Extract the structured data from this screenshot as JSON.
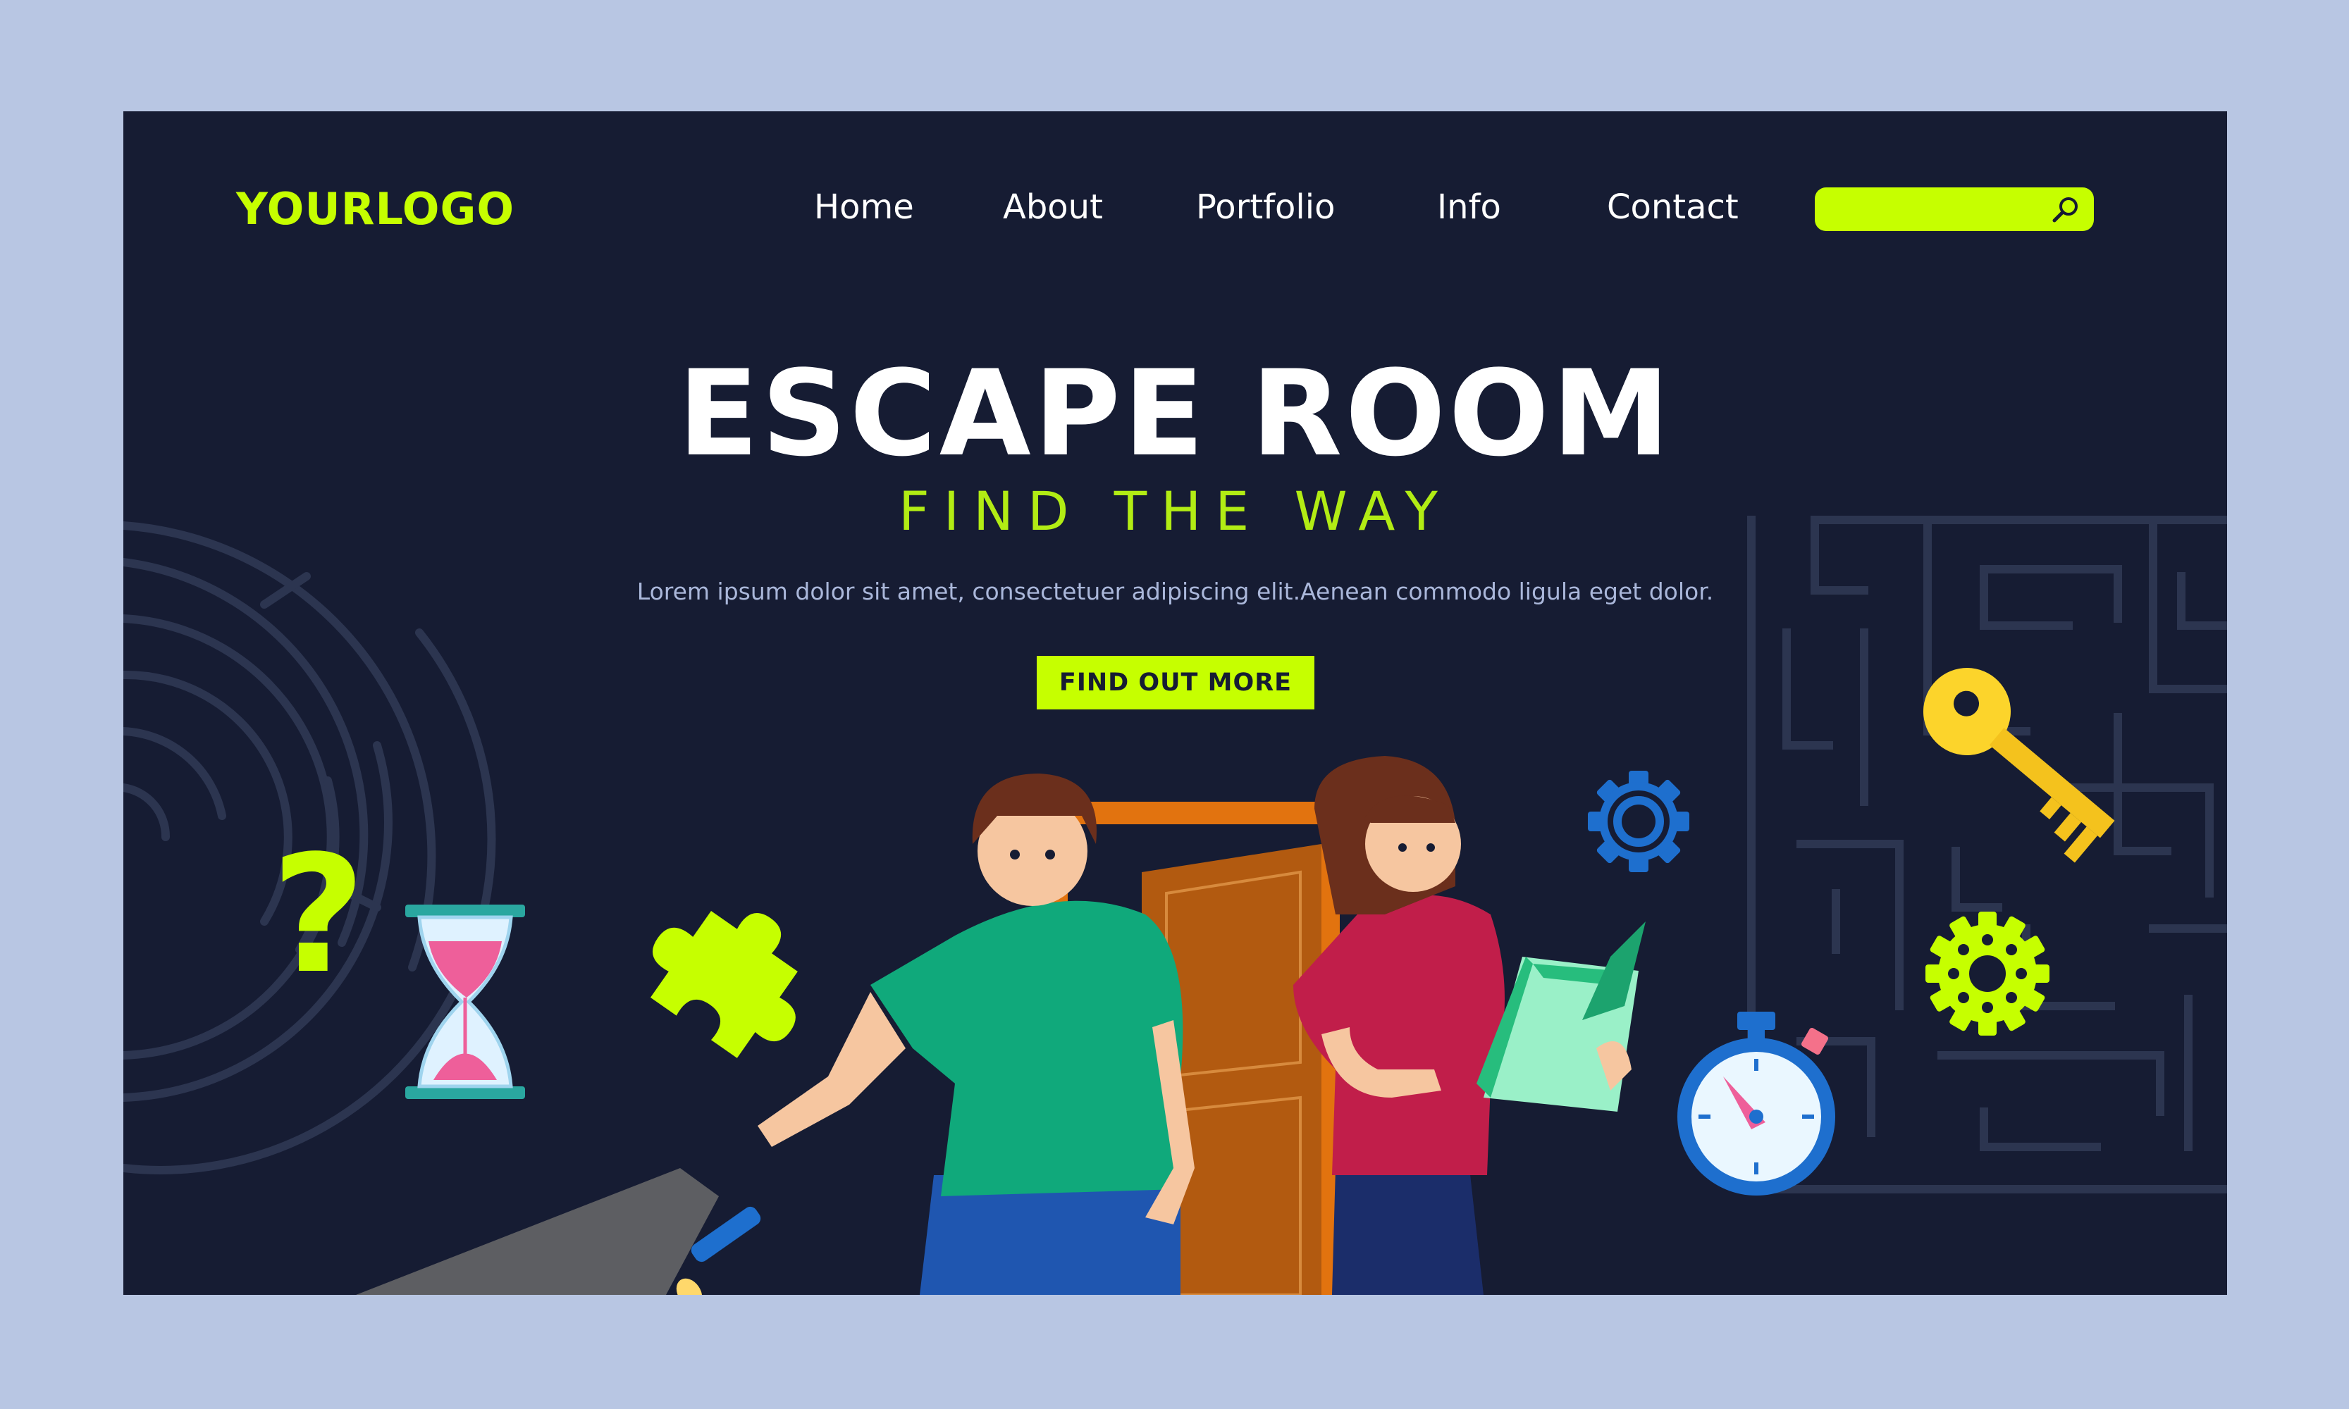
{
  "header": {
    "logo": "YOURLOGO",
    "nav": [
      {
        "label": "Home"
      },
      {
        "label": "About"
      },
      {
        "label": "Portfolio"
      },
      {
        "label": "Info"
      },
      {
        "label": "Contact"
      }
    ],
    "search": {
      "placeholder": "",
      "value": "",
      "icon": "search-icon"
    }
  },
  "hero": {
    "title": "ESCAPE ROOM",
    "subtitle": "FIND THE WAY",
    "body": "Lorem ipsum dolor sit amet, consectetuer adipiscing elit.Aenean commodo ligula eget dolor.",
    "cta_label": "FIND OUT MORE"
  },
  "illustration": {
    "icons": [
      "question-mark-icon",
      "hourglass-icon",
      "puzzle-piece-icon",
      "gear-icon",
      "key-icon",
      "stopwatch-icon",
      "flashlight-icon",
      "door-icon",
      "book-icon"
    ]
  },
  "colors": {
    "page_bg": "#b8c6e3",
    "panel_bg": "#161c33",
    "accent": "#c6ff00",
    "text": "#ffffff",
    "muted_text": "#aab7da",
    "maze_lines": "#2c3550"
  }
}
